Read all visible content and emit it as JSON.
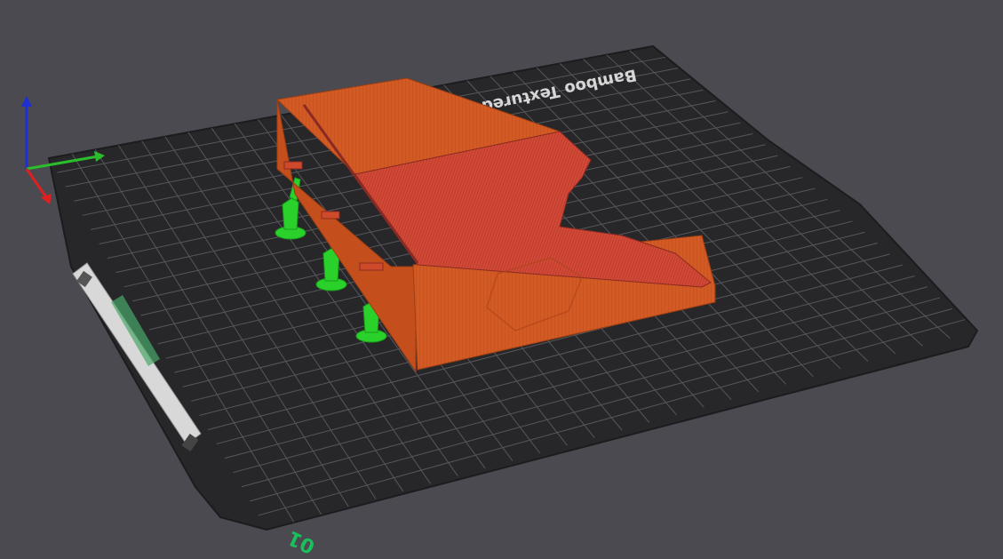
{
  "scene": {
    "background_color": "#4a4a50",
    "plate_label": "Bamboo Textured PEI Plate",
    "plate_number": "01",
    "plate_number_color": "#19c15a",
    "plate_color": "#27272a",
    "grid_color": "#6b6b70",
    "model_color": "#d35a22",
    "model_top_color": "#cf4a2a",
    "support_color": "#2bd12b",
    "axes": {
      "x_color": "#2bbd2b",
      "y_color": "#e02020",
      "z_color": "#1f2fd6"
    }
  }
}
